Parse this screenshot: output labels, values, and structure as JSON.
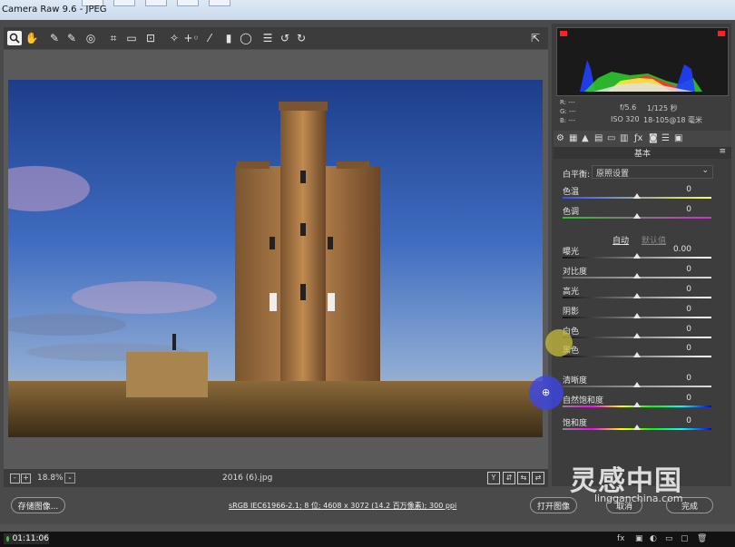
{
  "window": {
    "title": "Camera Raw 9.6 - JPEG"
  },
  "toolbar": {
    "tools": [
      "zoom-icon",
      "hand-icon",
      "white-balance-icon",
      "color-sampler-icon",
      "target-adjust-icon",
      "crop-icon",
      "straighten-icon",
      "transform-icon",
      "spot-removal-icon",
      "red-eye-icon",
      "brush-icon",
      "graduated-filter-icon",
      "radial-filter-icon",
      "list-icon",
      "rotate-left-icon",
      "rotate-right-icon"
    ],
    "fullscreen_icon": "fullscreen-icon"
  },
  "status": {
    "zoom": "18.8%",
    "filename": "2016 (6).jpg"
  },
  "bottom": {
    "save_button": "存储图像...",
    "workflow_link": "sRGB IEC61966-2.1; 8 位; 4608 x 3072 (14.2 百万像素); 300 ppi",
    "open_button": "打开图像",
    "cancel_button": "取消",
    "done_button": "完成"
  },
  "histogram_info": {
    "r": "R:  ---",
    "g": "G:  ---",
    "b": "B:  ---",
    "aperture": "f/5.6",
    "shutter": "1/125 秒",
    "iso": "ISO 320",
    "lens": "18-105@18 毫米"
  },
  "panel": {
    "section": "基本",
    "white_balance_label": "白平衡:",
    "white_balance_value": "原照设置",
    "auto": "自动",
    "default": "默认值",
    "sliders": [
      {
        "label": "色温",
        "value": "0",
        "pos": 0.5
      },
      {
        "label": "色调",
        "value": "0",
        "pos": 0.5
      },
      {
        "label": "曝光",
        "value": "0.00",
        "pos": 0.5
      },
      {
        "label": "对比度",
        "value": "0",
        "pos": 0.5
      },
      {
        "label": "高光",
        "value": "0",
        "pos": 0.5
      },
      {
        "label": "阴影",
        "value": "0",
        "pos": 0.5
      },
      {
        "label": "白色",
        "value": "0",
        "pos": 0.5
      },
      {
        "label": "黑色",
        "value": "0",
        "pos": 0.5
      },
      {
        "label": "清晰度",
        "value": "0",
        "pos": 0.5
      },
      {
        "label": "自然饱和度",
        "value": "0",
        "pos": 0.5
      },
      {
        "label": "饱和度",
        "value": "0",
        "pos": 0.5
      }
    ]
  },
  "taskbar": {
    "clock": "01:11:06"
  },
  "watermark": {
    "brand": "灵感中国",
    "url": "lingganchina.com"
  }
}
